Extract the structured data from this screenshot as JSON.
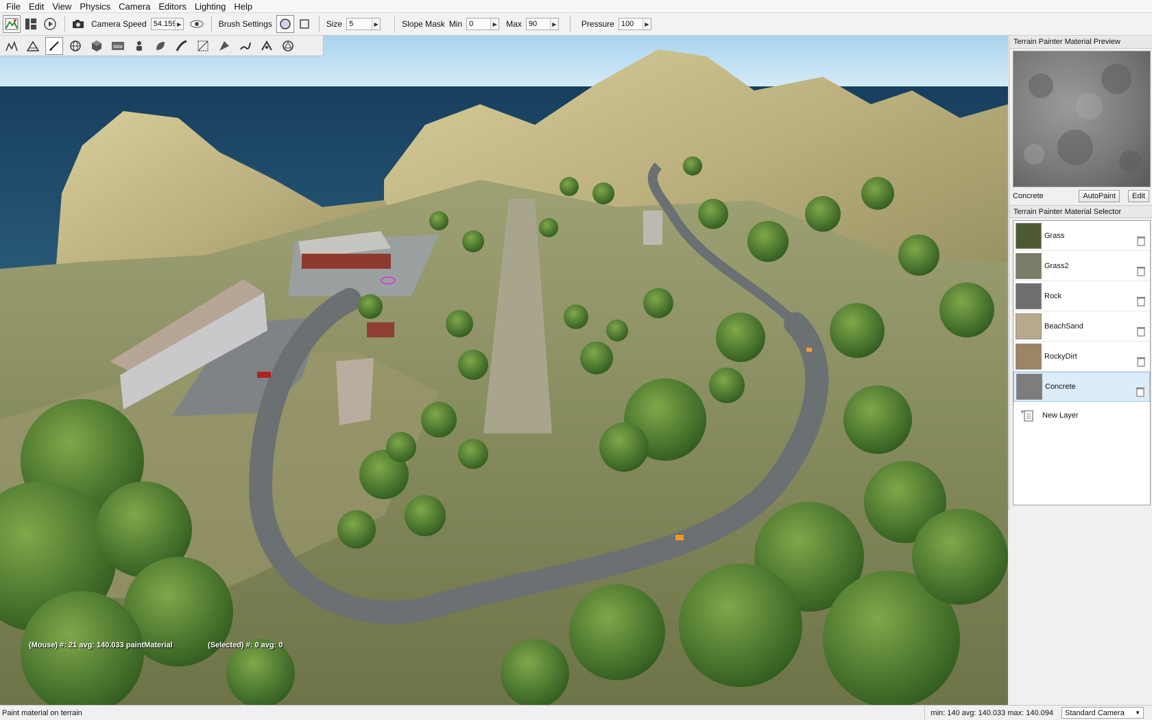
{
  "menu": [
    "File",
    "Edit",
    "View",
    "Physics",
    "Camera",
    "Editors",
    "Lighting",
    "Help"
  ],
  "toolbar": {
    "camera_speed_label": "Camera Speed",
    "camera_speed_value": "54.159",
    "brush_settings_label": "Brush Settings",
    "size_label": "Size",
    "size_value": "5",
    "slope_mask_label": "Slope Mask",
    "min_label": "Min",
    "min_value": "0",
    "max_label": "Max",
    "max_value": "90",
    "pressure_label": "Pressure",
    "pressure_value": "100"
  },
  "tools": [
    "terrain-heightmap",
    "terrain-editor",
    "terrain-painter",
    "world-globe",
    "object-cube",
    "datablock",
    "spawn-person",
    "forest",
    "road",
    "mesh-road",
    "decal",
    "river",
    "navmesh",
    "shape-editor"
  ],
  "viewport": {
    "hud_mouse": "(Mouse) #: 21  avg: 140.033 paintMaterial",
    "hud_selected": "(Selected) #: 0  avg: 0"
  },
  "preview_panel": {
    "title": "Terrain Painter Material Preview",
    "material_name": "Concrete",
    "autopaint_label": "AutoPaint",
    "edit_label": "Edit"
  },
  "selector_panel": {
    "title": "Terrain Painter Material Selector",
    "materials": [
      {
        "name": "Grass",
        "color": "#4e5a34"
      },
      {
        "name": "Grass2",
        "color": "#7a7c68"
      },
      {
        "name": "Rock",
        "color": "#6e6e70"
      },
      {
        "name": "BeachSand",
        "color": "#b8a98c"
      },
      {
        "name": "RockyDirt",
        "color": "#9b8563"
      },
      {
        "name": "Concrete",
        "color": "#7d7d7d"
      }
    ],
    "selected": "Concrete",
    "new_layer_label": "New Layer"
  },
  "statusbar": {
    "message": "Paint material on terrain",
    "stats": "min: 140  avg: 140.033  max: 140.094",
    "camera": "Standard Camera"
  }
}
